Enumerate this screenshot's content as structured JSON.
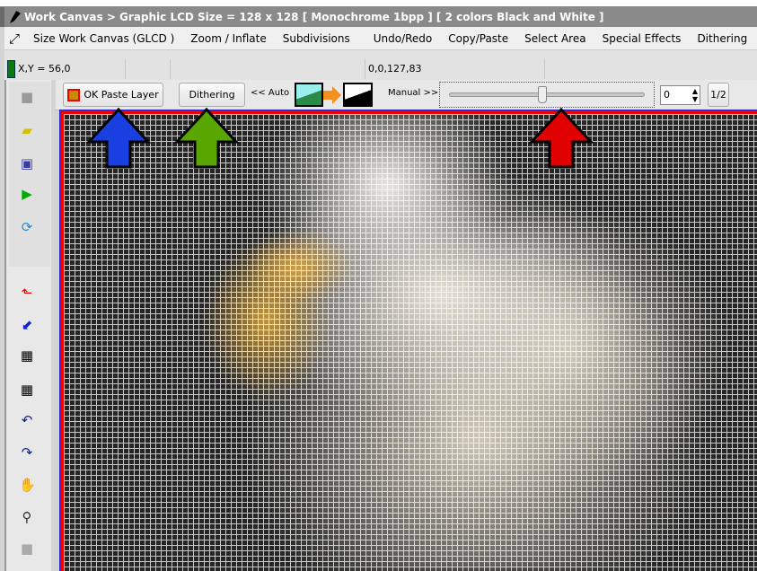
{
  "window": {
    "title": "Work Canvas > Graphic LCD Size = 128 x 128 [ Monochrome 1bpp ] [ 2 colors Black and White ]"
  },
  "menu": [
    "Size Work Canvas (GLCD )",
    "Zoom / Inflate",
    "Subdivisions",
    "Undo/Redo",
    "Copy/Paste",
    "Select Area",
    "Special Effects",
    "Dithering"
  ],
  "status": {
    "xy": "X,Y = 56,0",
    "selection": "0,0,127,83"
  },
  "toolbar": {
    "paste_label": "OK Paste Layer",
    "dither_label": "Dithering",
    "auto_label": "<< Auto",
    "manual_label": "Manual >>",
    "threshold_value": "0",
    "half_label": "1/2",
    "slider_fraction": 0.47
  },
  "sidebar": {
    "icons": [
      "plugin-icon",
      "open-folder-icon",
      "save-icon",
      "play-icon",
      "refresh-icon",
      "crop-icon",
      "import-icon",
      "grid-fine-icon",
      "grid-icon",
      "undo-icon",
      "redo-icon",
      "hand-icon",
      "zoom-in-icon",
      "plugin-icon"
    ]
  },
  "annotations": {
    "arrow_colors": [
      "#1a3fe0",
      "#5aa600",
      "#e00000"
    ]
  }
}
